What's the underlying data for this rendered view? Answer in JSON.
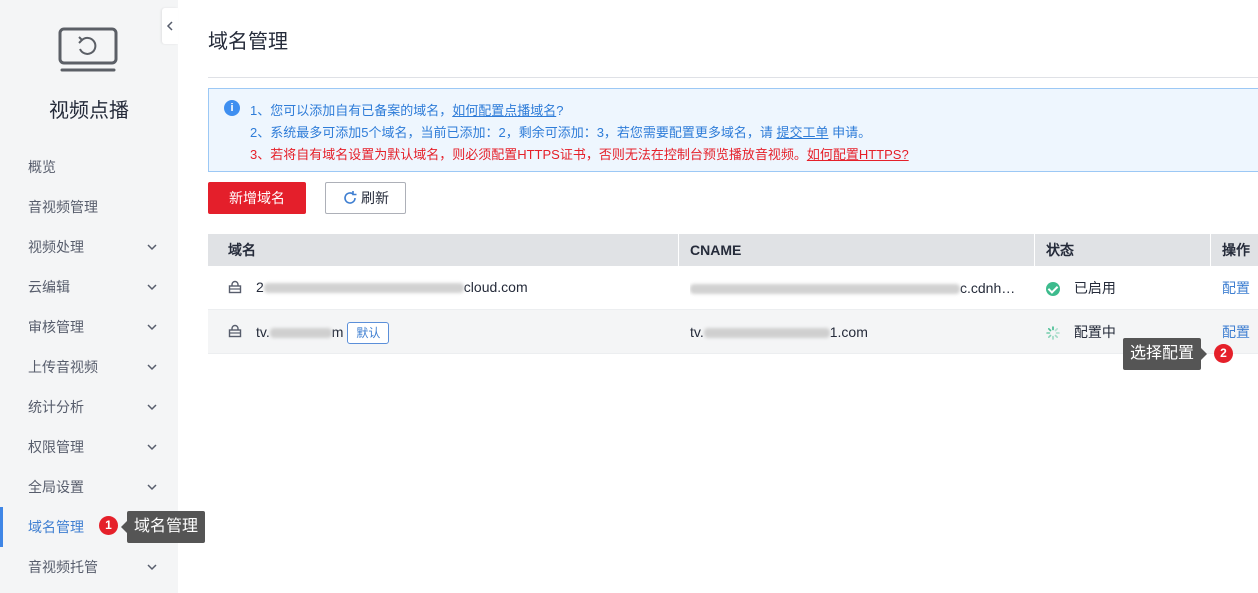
{
  "sidebar": {
    "title": "视频点播",
    "items": [
      {
        "label": "概览",
        "has_arrow": false
      },
      {
        "label": "音视频管理",
        "has_arrow": false
      },
      {
        "label": "视频处理",
        "has_arrow": true
      },
      {
        "label": "云编辑",
        "has_arrow": true
      },
      {
        "label": "审核管理",
        "has_arrow": true
      },
      {
        "label": "上传音视频",
        "has_arrow": true
      },
      {
        "label": "统计分析",
        "has_arrow": true
      },
      {
        "label": "权限管理",
        "has_arrow": true
      },
      {
        "label": "全局设置",
        "has_arrow": true
      },
      {
        "label": "域名管理",
        "has_arrow": false,
        "active": true
      },
      {
        "label": "音视频托管",
        "has_arrow": true
      }
    ]
  },
  "steps": [
    {
      "number": "1",
      "label": "域名管理"
    },
    {
      "number": "2",
      "label": "选择配置"
    }
  ],
  "page": {
    "title": "域名管理"
  },
  "notice": {
    "line1_text": "1、您可以添加自有已备案的域名，",
    "line1_link": "如何配置点播域名",
    "line1_end": "?",
    "line2_text": "2、系统最多可添加5个域名，当前已添加：2，剩余可添加：3，若您需要配置更多域名，请 ",
    "line2_link": "提交工单",
    "line2_end": " 申请。",
    "line3_text": "3、若将自有域名设置为默认域名，则必须配置HTTPS证书，否则无法在控制台预览播放音视频。",
    "line3_link": "如何配置HTTPS?"
  },
  "toolbar": {
    "add_label": "新增域名",
    "refresh_label": "刷新"
  },
  "table": {
    "headers": [
      "域名",
      "CNAME",
      "状态",
      "操作"
    ],
    "rows": [
      {
        "domain_prefix": "2",
        "domain_suffix": "cloud.com",
        "cname_prefix": "",
        "cname_suffix": "c.cdnh…",
        "status": "已启用",
        "status_type": "enabled",
        "action": "配置",
        "is_default": false
      },
      {
        "domain_prefix": "tv.",
        "domain_suffix": "m",
        "cname_prefix": "tv.",
        "cname_suffix": "1.com",
        "status": "配置中",
        "status_type": "configuring",
        "action": "配置",
        "is_default": true,
        "default_tag": "默认"
      }
    ]
  },
  "colors": {
    "accent_red": "#e41f2b",
    "link_blue": "#3f7fd1",
    "enabled_green": "#3dbb8d",
    "notice_bg": "#eef6fe"
  }
}
